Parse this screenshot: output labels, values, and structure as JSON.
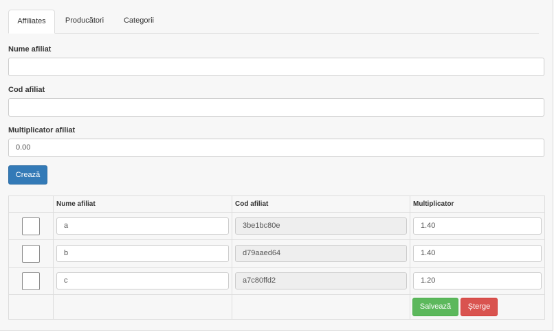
{
  "tabs": [
    {
      "label": "Affiliates",
      "active": true
    },
    {
      "label": "Producători",
      "active": false
    },
    {
      "label": "Categorii",
      "active": false
    }
  ],
  "form": {
    "name_label": "Nume afiliat",
    "name_value": "",
    "code_label": "Cod afiliat",
    "code_value": "",
    "multiplier_label": "Multiplicator afiliat",
    "multiplier_value": "0.00",
    "create_button": "Crează"
  },
  "table": {
    "headers": [
      "",
      "Nume afiliat",
      "Cod afiliat",
      "Multiplicator"
    ],
    "rows": [
      {
        "checked": false,
        "name": "a",
        "code": "3be1bc80e",
        "multiplier": "1.40"
      },
      {
        "checked": false,
        "name": "b",
        "code": "d79aaed64",
        "multiplier": "1.40"
      },
      {
        "checked": false,
        "name": "c",
        "code": "a7c80ffd2",
        "multiplier": "1.20"
      }
    ],
    "save_button": "Salvează",
    "delete_button": "Șterge"
  },
  "colors": {
    "primary": "#337ab7",
    "success": "#5cb85c",
    "danger": "#d9534f",
    "panel_background": "#f7f7f7",
    "readonly_background": "#eeeeee"
  }
}
